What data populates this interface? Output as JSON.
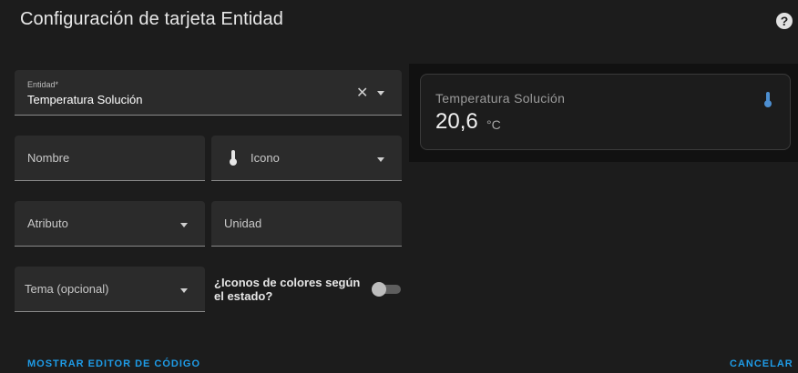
{
  "dialog": {
    "title": "Configuración de tarjeta Entidad",
    "help_icon": "help-circle-icon"
  },
  "form": {
    "entity": {
      "label": "Entidad*",
      "value": "Temperatura Solución"
    },
    "name": {
      "label": "Nombre"
    },
    "icon": {
      "label": "Icono",
      "icon": "thermometer-icon"
    },
    "attribute": {
      "label": "Atributo"
    },
    "unit": {
      "label": "Unidad"
    },
    "theme": {
      "label": "Tema (opcional)"
    },
    "state_color": {
      "label": "¿Iconos de colores según el estado?",
      "checked": false
    }
  },
  "preview": {
    "name": "Temperatura Solución",
    "state": "20,6",
    "unit": "°C",
    "icon": "thermometer-icon",
    "icon_color": "#4d8fd1"
  },
  "actions": {
    "show_code_editor": "MOSTRAR EDITOR DE CÓDIGO",
    "cancel": "CANCELAR"
  },
  "colors": {
    "accent": "#1e9ce8",
    "background": "#1c1c1c",
    "field": "#2b2b2b"
  }
}
